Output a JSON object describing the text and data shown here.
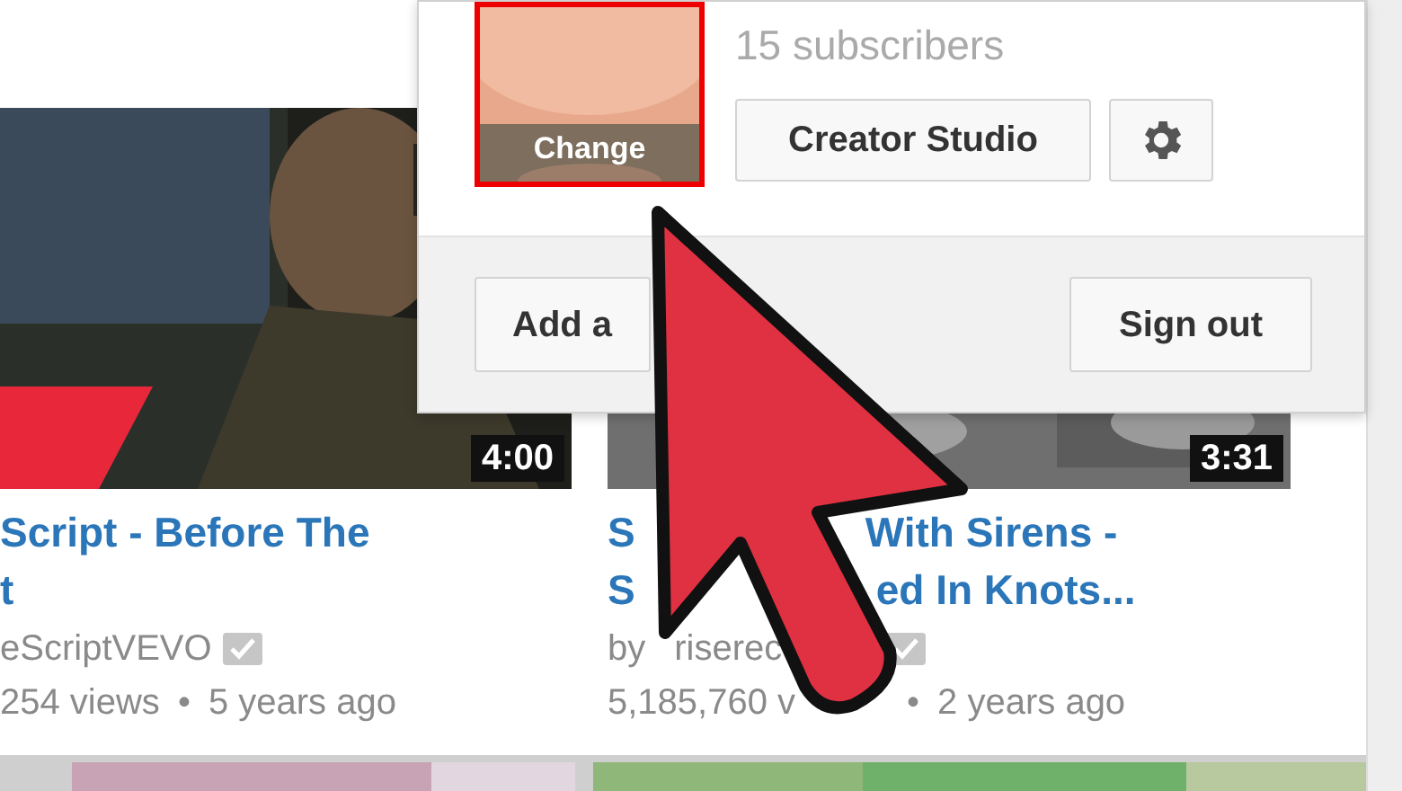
{
  "videos": [
    {
      "title_lines": [
        [
          "Script - Before The"
        ],
        [
          "t"
        ]
      ],
      "channel": [
        "eScriptVEVO"
      ],
      "verified": true,
      "stats": [
        "254 views",
        "•",
        "5 years ago"
      ],
      "duration": "4:00"
    },
    {
      "title_lines": [
        [
          "S",
          "With Sirens -"
        ],
        [
          "S",
          "ed In Knots..."
        ]
      ],
      "channel": [
        "by",
        "riserec"
      ],
      "verified": true,
      "stats": [
        "5,185,760 v",
        "•",
        "2 years ago"
      ],
      "duration": "3:31"
    }
  ],
  "account_menu": {
    "subscribers": "15 subscribers",
    "avatar": {
      "kind": "picture",
      "overlay_label": "Change"
    },
    "studio_button": "Creator Studio",
    "footer_buttons": [
      "Add a",
      "Sign out"
    ]
  }
}
